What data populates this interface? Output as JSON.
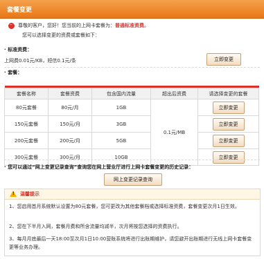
{
  "header": {
    "title": "套餐变更"
  },
  "notice": {
    "prefix": "尊敬的客户，您好！您当前的上网卡套餐为：",
    "current_package": "普通标准资费",
    "suffix": "。",
    "line2": "您可以选择变更的资费或套餐如下："
  },
  "standard": {
    "label": "· 标准资费：",
    "info": "上网费0.01元/KB，短信0.1元/条",
    "button": "立即变更"
  },
  "packages": {
    "label": "· 套餐：",
    "headers": [
      "套餐名称",
      "套餐资费",
      "包含国内流量",
      "超出后资费",
      "请选择变更的套餐"
    ],
    "overage": "0.1元/MB",
    "rows": [
      {
        "name": "80元套餐",
        "fee": "80元/月",
        "traffic": "1GB",
        "button": "立即变更"
      },
      {
        "name": "150元套餐",
        "fee": "150元/月",
        "traffic": "3GB",
        "button": "立即变更"
      },
      {
        "name": "200元套餐",
        "fee": "200元/月",
        "traffic": "5GB",
        "button": "立即变更"
      },
      {
        "name": "300元套餐",
        "fee": "300元/月",
        "traffic": "10GB",
        "button": "立即变更"
      }
    ]
  },
  "history": {
    "text": "· 您可以通过“网上变更记录查询”查询您在网上营业厅进行上网卡套餐变更的历史记录：",
    "button": "网上变更记录查询"
  },
  "tips": {
    "title": "温馨提示",
    "items": [
      "1、您启用首月系统默认设置为80元套餐，您可更改为其他套餐档或选择标准资费，套餐变更次月1日生效。",
      "2、您在下半月入网，套餐月费和所含流量均减半，次月将按您选择的资费执行。",
      "3、每月月底最后一天18:00至次月1日10:00营账系统将进行出账期维护，请您避开出账期进行无线上网卡套餐变更等业务办理。"
    ]
  },
  "colors": {
    "accent": "#e77717",
    "highlight": "#d8322a"
  }
}
